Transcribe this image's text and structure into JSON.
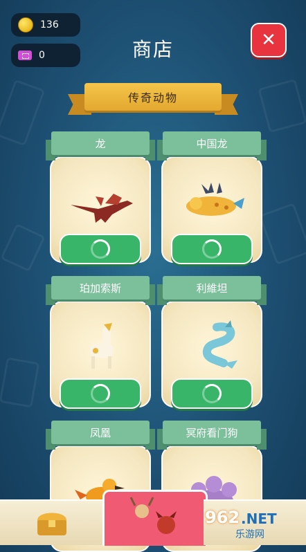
{
  "header": {
    "title": "商店",
    "coins": "136",
    "tickets": "0"
  },
  "section": {
    "title": "传奇动物"
  },
  "cards": [
    {
      "name": "龙"
    },
    {
      "name": "中国龙"
    },
    {
      "name": "珀加索斯"
    },
    {
      "name": "利維坦"
    },
    {
      "name": "凤凰"
    },
    {
      "name": "冥府看门狗"
    }
  ],
  "watermark": {
    "brand": "962",
    "suffix": ".NET",
    "sub": "乐游网"
  },
  "icons": {
    "close": "close-icon",
    "coin": "coin-icon",
    "ticket": "ticket-icon",
    "loading": "spinner-icon",
    "treasure": "treasure-chest-icon"
  },
  "colors": {
    "accent": "#e8343e",
    "buy": "#39b56a",
    "ribbon": "#7bc09a",
    "section": "#f5c54a"
  }
}
